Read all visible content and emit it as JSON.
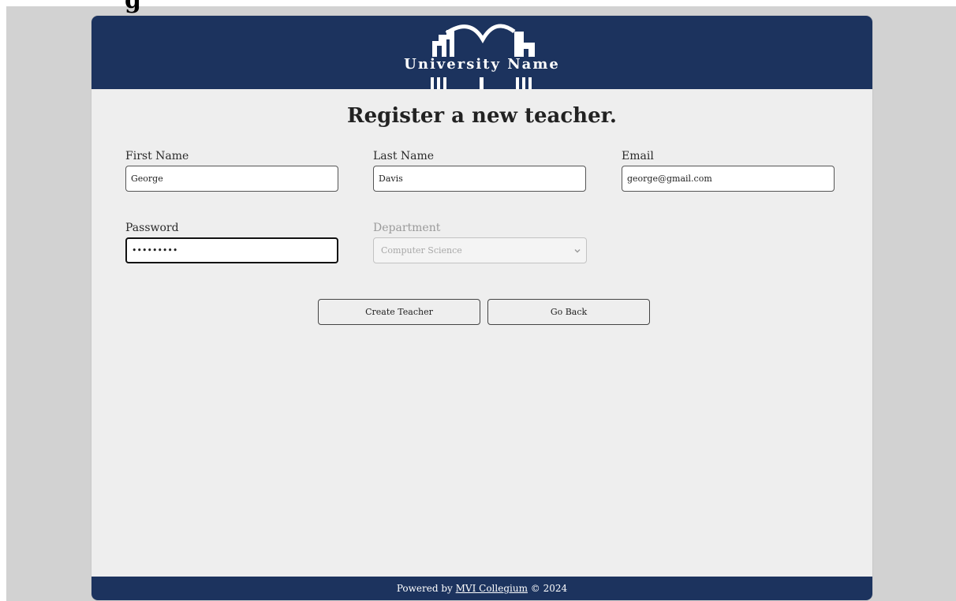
{
  "brand": {
    "university_name": "University Name",
    "header_color": "#1c335e",
    "logo_icon": "university-building-logo"
  },
  "page": {
    "title": "Register a new teacher."
  },
  "form": {
    "first_name": {
      "label": "First Name",
      "value": "George"
    },
    "last_name": {
      "label": "Last Name",
      "value": "Davis"
    },
    "email": {
      "label": "Email",
      "value": "george@gmail.com"
    },
    "password": {
      "label": "Password",
      "value": "•••••••••"
    },
    "department": {
      "label": "Department",
      "selected": "Computer Science",
      "disabled": true
    }
  },
  "actions": {
    "create_label": "Create Teacher",
    "back_label": "Go Back"
  },
  "footer": {
    "prefix": "Powered by",
    "link_text": "MVI Collegium",
    "suffix": "© 2024"
  }
}
